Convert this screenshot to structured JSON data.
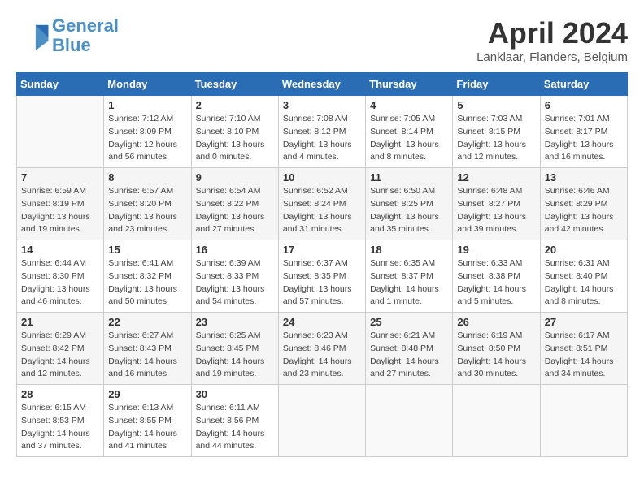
{
  "header": {
    "logo_line1": "General",
    "logo_line2": "Blue",
    "month": "April 2024",
    "location": "Lanklaar, Flanders, Belgium"
  },
  "columns": [
    "Sunday",
    "Monday",
    "Tuesday",
    "Wednesday",
    "Thursday",
    "Friday",
    "Saturday"
  ],
  "weeks": [
    [
      {
        "day": "",
        "info": ""
      },
      {
        "day": "1",
        "info": "Sunrise: 7:12 AM\nSunset: 8:09 PM\nDaylight: 12 hours\nand 56 minutes."
      },
      {
        "day": "2",
        "info": "Sunrise: 7:10 AM\nSunset: 8:10 PM\nDaylight: 13 hours\nand 0 minutes."
      },
      {
        "day": "3",
        "info": "Sunrise: 7:08 AM\nSunset: 8:12 PM\nDaylight: 13 hours\nand 4 minutes."
      },
      {
        "day": "4",
        "info": "Sunrise: 7:05 AM\nSunset: 8:14 PM\nDaylight: 13 hours\nand 8 minutes."
      },
      {
        "day": "5",
        "info": "Sunrise: 7:03 AM\nSunset: 8:15 PM\nDaylight: 13 hours\nand 12 minutes."
      },
      {
        "day": "6",
        "info": "Sunrise: 7:01 AM\nSunset: 8:17 PM\nDaylight: 13 hours\nand 16 minutes."
      }
    ],
    [
      {
        "day": "7",
        "info": "Sunrise: 6:59 AM\nSunset: 8:19 PM\nDaylight: 13 hours\nand 19 minutes."
      },
      {
        "day": "8",
        "info": "Sunrise: 6:57 AM\nSunset: 8:20 PM\nDaylight: 13 hours\nand 23 minutes."
      },
      {
        "day": "9",
        "info": "Sunrise: 6:54 AM\nSunset: 8:22 PM\nDaylight: 13 hours\nand 27 minutes."
      },
      {
        "day": "10",
        "info": "Sunrise: 6:52 AM\nSunset: 8:24 PM\nDaylight: 13 hours\nand 31 minutes."
      },
      {
        "day": "11",
        "info": "Sunrise: 6:50 AM\nSunset: 8:25 PM\nDaylight: 13 hours\nand 35 minutes."
      },
      {
        "day": "12",
        "info": "Sunrise: 6:48 AM\nSunset: 8:27 PM\nDaylight: 13 hours\nand 39 minutes."
      },
      {
        "day": "13",
        "info": "Sunrise: 6:46 AM\nSunset: 8:29 PM\nDaylight: 13 hours\nand 42 minutes."
      }
    ],
    [
      {
        "day": "14",
        "info": "Sunrise: 6:44 AM\nSunset: 8:30 PM\nDaylight: 13 hours\nand 46 minutes."
      },
      {
        "day": "15",
        "info": "Sunrise: 6:41 AM\nSunset: 8:32 PM\nDaylight: 13 hours\nand 50 minutes."
      },
      {
        "day": "16",
        "info": "Sunrise: 6:39 AM\nSunset: 8:33 PM\nDaylight: 13 hours\nand 54 minutes."
      },
      {
        "day": "17",
        "info": "Sunrise: 6:37 AM\nSunset: 8:35 PM\nDaylight: 13 hours\nand 57 minutes."
      },
      {
        "day": "18",
        "info": "Sunrise: 6:35 AM\nSunset: 8:37 PM\nDaylight: 14 hours\nand 1 minute."
      },
      {
        "day": "19",
        "info": "Sunrise: 6:33 AM\nSunset: 8:38 PM\nDaylight: 14 hours\nand 5 minutes."
      },
      {
        "day": "20",
        "info": "Sunrise: 6:31 AM\nSunset: 8:40 PM\nDaylight: 14 hours\nand 8 minutes."
      }
    ],
    [
      {
        "day": "21",
        "info": "Sunrise: 6:29 AM\nSunset: 8:42 PM\nDaylight: 14 hours\nand 12 minutes."
      },
      {
        "day": "22",
        "info": "Sunrise: 6:27 AM\nSunset: 8:43 PM\nDaylight: 14 hours\nand 16 minutes."
      },
      {
        "day": "23",
        "info": "Sunrise: 6:25 AM\nSunset: 8:45 PM\nDaylight: 14 hours\nand 19 minutes."
      },
      {
        "day": "24",
        "info": "Sunrise: 6:23 AM\nSunset: 8:46 PM\nDaylight: 14 hours\nand 23 minutes."
      },
      {
        "day": "25",
        "info": "Sunrise: 6:21 AM\nSunset: 8:48 PM\nDaylight: 14 hours\nand 27 minutes."
      },
      {
        "day": "26",
        "info": "Sunrise: 6:19 AM\nSunset: 8:50 PM\nDaylight: 14 hours\nand 30 minutes."
      },
      {
        "day": "27",
        "info": "Sunrise: 6:17 AM\nSunset: 8:51 PM\nDaylight: 14 hours\nand 34 minutes."
      }
    ],
    [
      {
        "day": "28",
        "info": "Sunrise: 6:15 AM\nSunset: 8:53 PM\nDaylight: 14 hours\nand 37 minutes."
      },
      {
        "day": "29",
        "info": "Sunrise: 6:13 AM\nSunset: 8:55 PM\nDaylight: 14 hours\nand 41 minutes."
      },
      {
        "day": "30",
        "info": "Sunrise: 6:11 AM\nSunset: 8:56 PM\nDaylight: 14 hours\nand 44 minutes."
      },
      {
        "day": "",
        "info": ""
      },
      {
        "day": "",
        "info": ""
      },
      {
        "day": "",
        "info": ""
      },
      {
        "day": "",
        "info": ""
      }
    ]
  ]
}
